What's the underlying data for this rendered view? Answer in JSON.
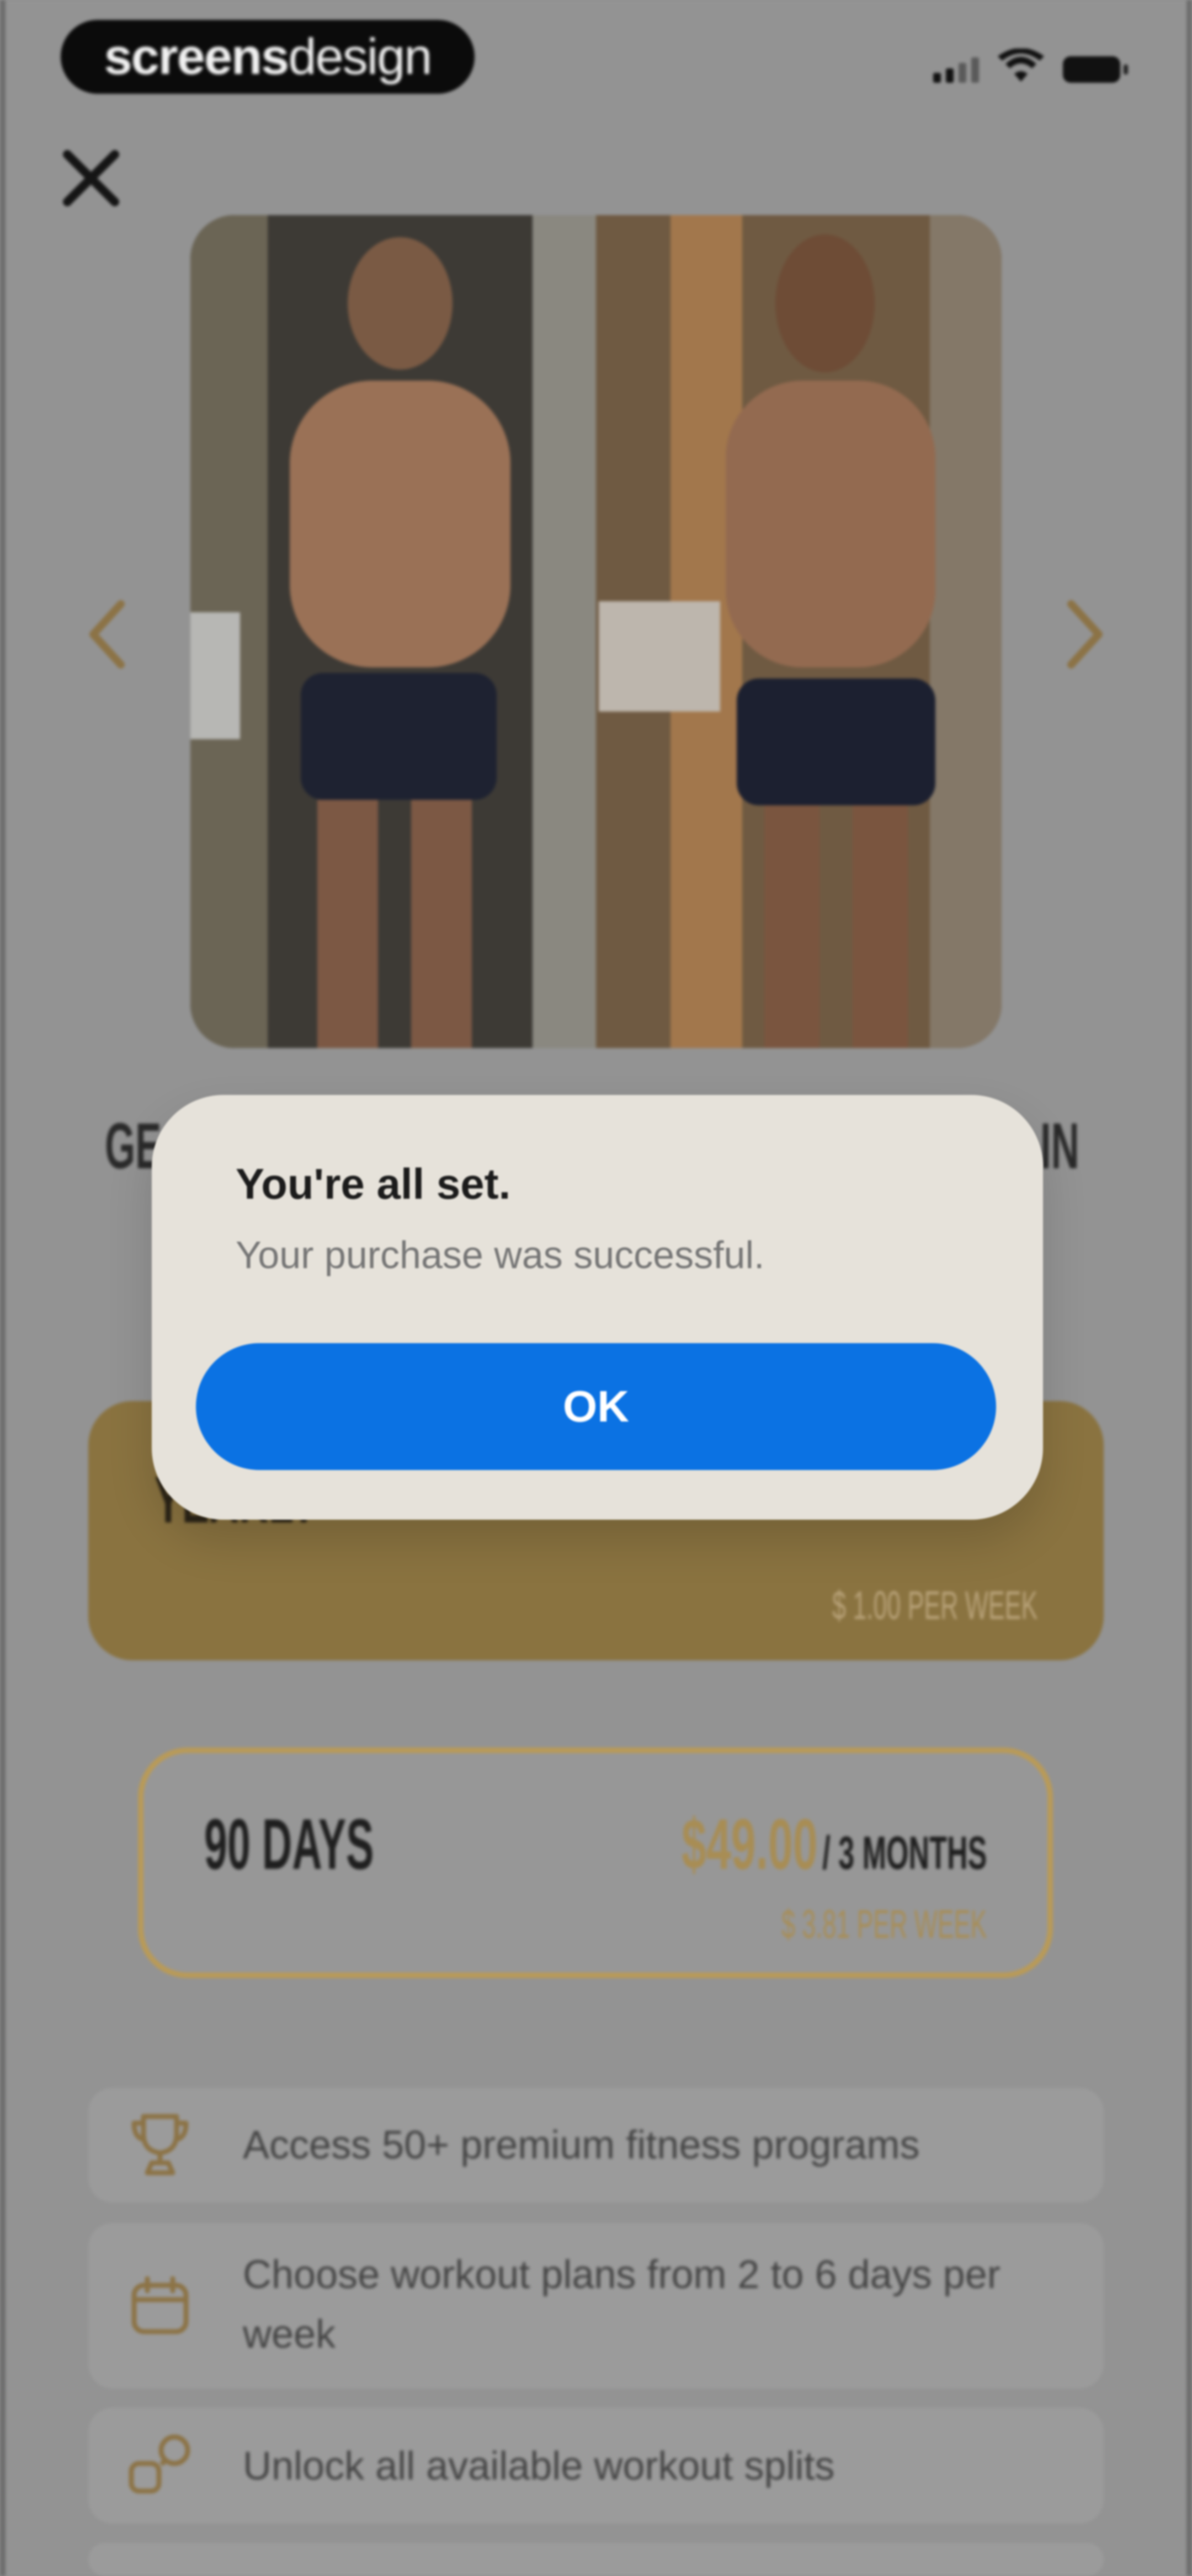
{
  "status_bar": {
    "brand_bold": "screens",
    "brand_light": "design"
  },
  "paywall": {
    "headline_left": "GE",
    "headline_right": "IN",
    "plans": [
      {
        "name": "YEARLY",
        "per_week": "$ 1.00 PER WEEK"
      },
      {
        "name": "90 DAYS",
        "price": "$49.00",
        "period": "/ 3 MONTHS",
        "per_week": "$ 3.81 PER WEEK"
      }
    ],
    "features": [
      {
        "icon": "trophy-icon",
        "text": "Access 50+ premium fitness programs"
      },
      {
        "icon": "calendar-icon",
        "text": "Choose workout plans from 2 to 6 days per week"
      },
      {
        "icon": "split-icon",
        "text": "Unlock all available workout splits"
      }
    ]
  },
  "dialog": {
    "title": "You're all set.",
    "message": "Your purchase was successful.",
    "ok_label": "OK"
  },
  "colors": {
    "accent_gold": "#b99a57",
    "button_blue": "#0b72e3"
  }
}
